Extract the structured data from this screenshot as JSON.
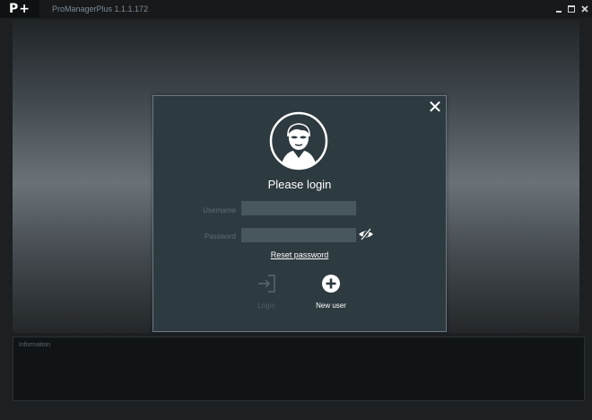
{
  "window": {
    "app_title": "ProManagerPlus 1.1.1.172",
    "logo_text": "P+",
    "controls": {
      "minimize_icon": "minimize-icon",
      "maximize_icon": "maximize-icon",
      "close_icon": "close-icon"
    }
  },
  "dialog": {
    "title": "Please login",
    "close_glyph": "✕",
    "avatar_icon": "user-avatar-icon",
    "username": {
      "label": "Username",
      "value": "",
      "placeholder": ""
    },
    "password": {
      "label": "Password",
      "value": "",
      "placeholder": ""
    },
    "show_password_icon": "eye-slash-icon",
    "reset_password_link": "Reset password",
    "login_button": {
      "label": "Login",
      "icon": "login-arrow-icon",
      "enabled": false
    },
    "new_user_button": {
      "label": "New user",
      "icon": "plus-circle-icon"
    }
  },
  "info_panel": {
    "title": "Information"
  },
  "colors": {
    "dialog_bg": "#2d3a40",
    "input_bg": "#48565d",
    "disabled_text": "#4f5d65",
    "title_text": "#ffffff"
  }
}
